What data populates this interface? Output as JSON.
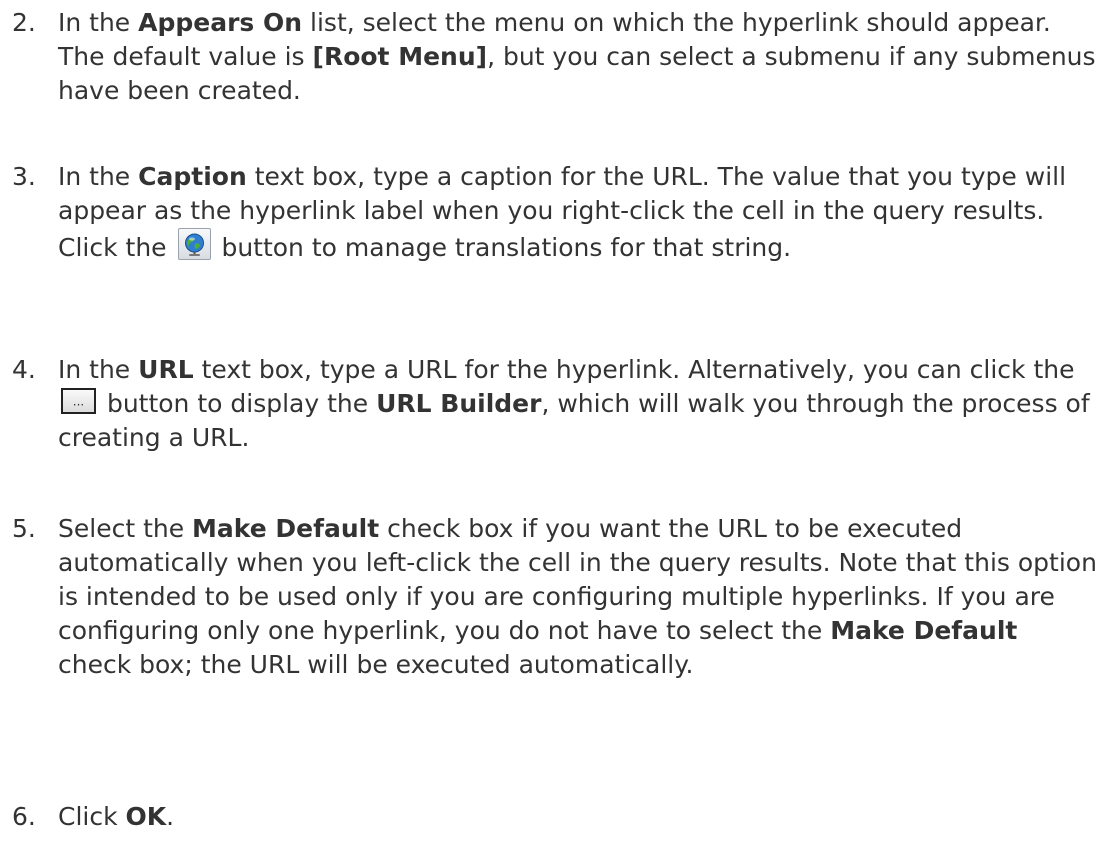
{
  "steps": [
    {
      "number": "2.",
      "segments": [
        {
          "text": "In the ",
          "bold": false
        },
        {
          "text": "Appears On",
          "bold": true
        },
        {
          "text": " list, select the menu on which the hyperlink should appear. The default value is ",
          "bold": false
        },
        {
          "text": "[Root Menu]",
          "bold": true
        },
        {
          "text": ", but you can select a submenu if any submenus have been created.",
          "bold": false
        }
      ]
    },
    {
      "number": "3.",
      "segments": [
        {
          "text": "In the ",
          "bold": false
        },
        {
          "text": "Caption",
          "bold": true
        },
        {
          "text": " text box, type a caption for the URL. The value that you type will appear as the hyperlink label when you right-click the cell in the query results. Click the ",
          "bold": false
        },
        {
          "icon": "globe-translate-icon"
        },
        {
          "text": " button to manage translations for that string.",
          "bold": false
        }
      ]
    },
    {
      "number": "4.",
      "segments": [
        {
          "text": "In the ",
          "bold": false
        },
        {
          "text": "URL",
          "bold": true
        },
        {
          "text": " text box, type a URL for the hyperlink. Alternatively, you can click the ",
          "bold": false
        },
        {
          "icon": "ellipsis-icon"
        },
        {
          "text": " button to display the ",
          "bold": false
        },
        {
          "text": "URL Builder",
          "bold": true
        },
        {
          "text": ", which will walk you through the process of creating a URL.",
          "bold": false
        }
      ]
    },
    {
      "number": "5.",
      "segments": [
        {
          "text": "Select the ",
          "bold": false
        },
        {
          "text": "Make Default",
          "bold": true
        },
        {
          "text": " check box if you want the URL to be executed automatically when you left-click the cell in the query results. Note that this option is intended to be used only if you are configuring multiple hyperlinks. If you are configuring only one hyperlink, you do not have to select the ",
          "bold": false
        },
        {
          "text": "Make Default",
          "bold": true
        },
        {
          "text": " check box; the URL will be executed automatically.",
          "bold": false
        }
      ]
    },
    {
      "number": "6.",
      "segments": [
        {
          "text": "Click ",
          "bold": false
        },
        {
          "text": "OK",
          "bold": true
        },
        {
          "text": ".",
          "bold": false
        }
      ]
    }
  ],
  "colors": {
    "text": "#333333",
    "background": "#ffffff"
  }
}
